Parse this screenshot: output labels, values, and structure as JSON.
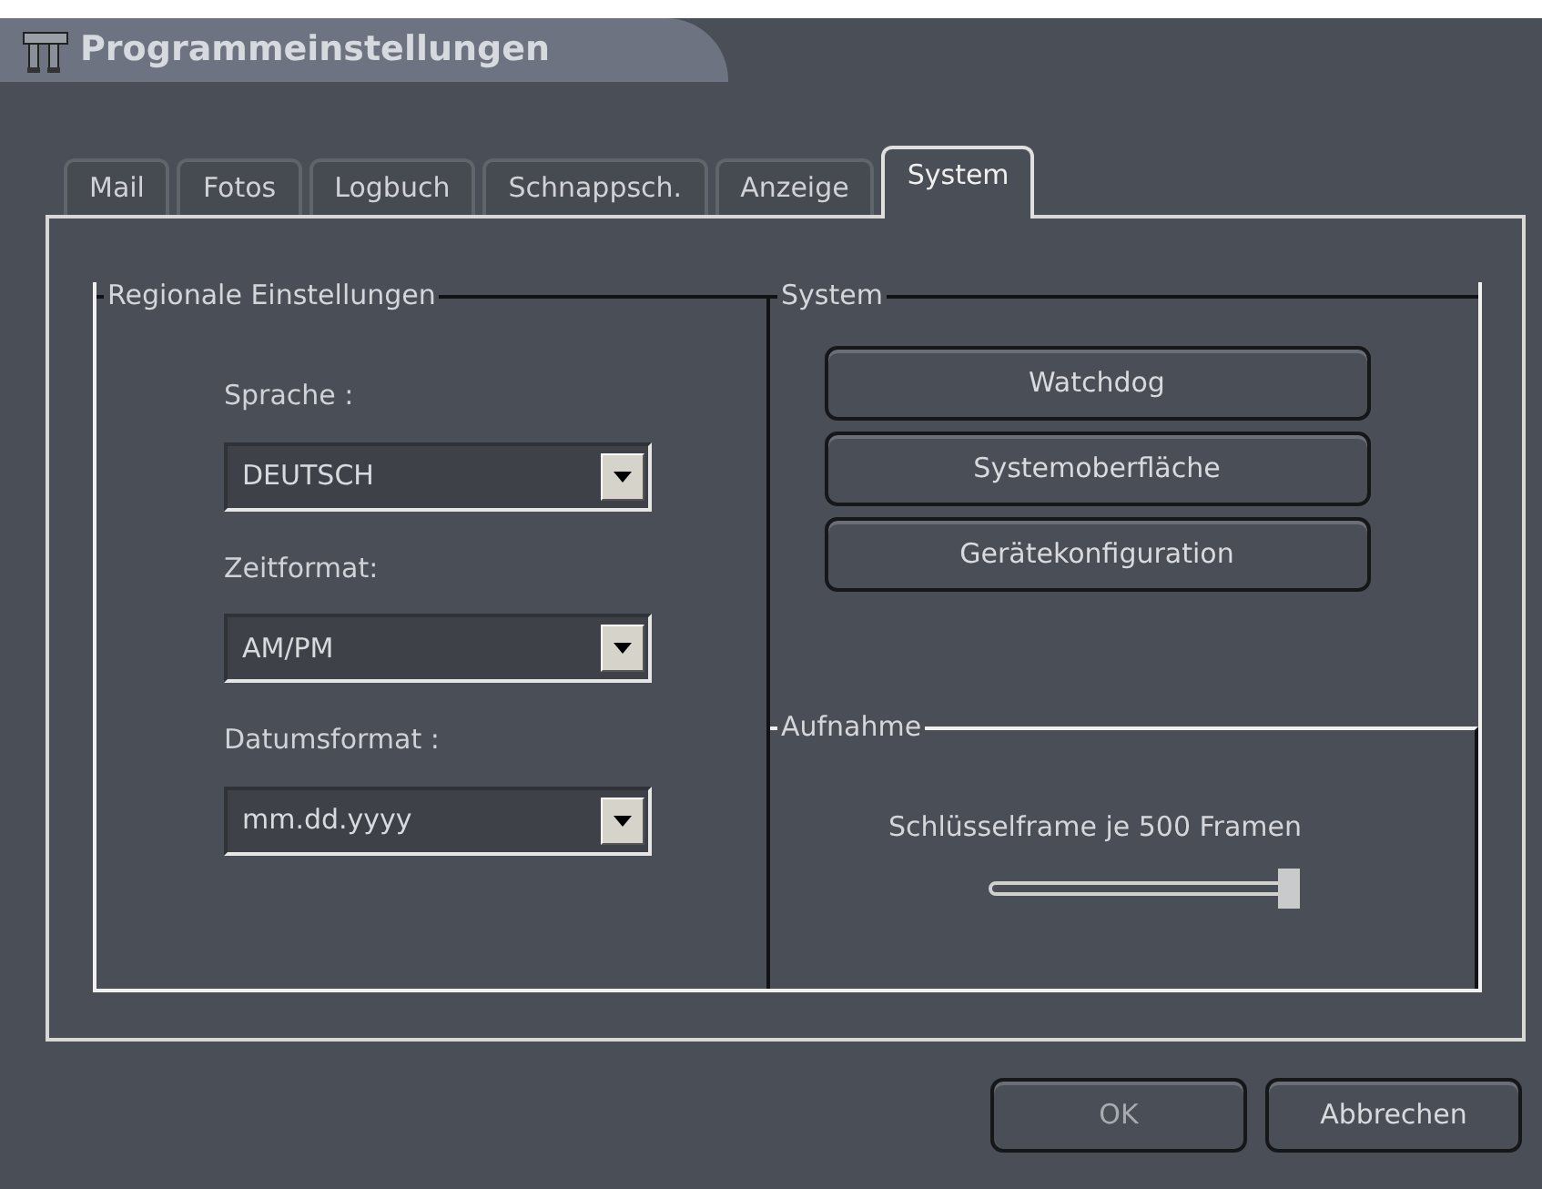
{
  "window": {
    "title": "Programmeinstellungen"
  },
  "tabs": [
    {
      "label": "Mail",
      "selected": false
    },
    {
      "label": "Fotos",
      "selected": false
    },
    {
      "label": "Logbuch",
      "selected": false
    },
    {
      "label": "Schnappsch.",
      "selected": false
    },
    {
      "label": "Anzeige",
      "selected": false
    },
    {
      "label": "System",
      "selected": true
    }
  ],
  "regional": {
    "title": "Regionale Einstellungen",
    "fields": [
      {
        "label": "Sprache :",
        "value": "DEUTSCH"
      },
      {
        "label": "Zeitformat:",
        "value": "AM/PM"
      },
      {
        "label": "Datumsformat :",
        "value": "mm.dd.yyyy"
      }
    ]
  },
  "system": {
    "title": "System",
    "buttons": [
      "Watchdog",
      "Systemoberfläche",
      "Gerätekonfiguration"
    ]
  },
  "recording": {
    "title": "Aufnahme",
    "slider": {
      "label": "Schlüsselframe je 500 Framen",
      "level": 0.97
    }
  },
  "buttons": [
    {
      "label": "OK",
      "disabled": true
    },
    {
      "label": "Abbrechen",
      "disabled": false
    }
  ]
}
